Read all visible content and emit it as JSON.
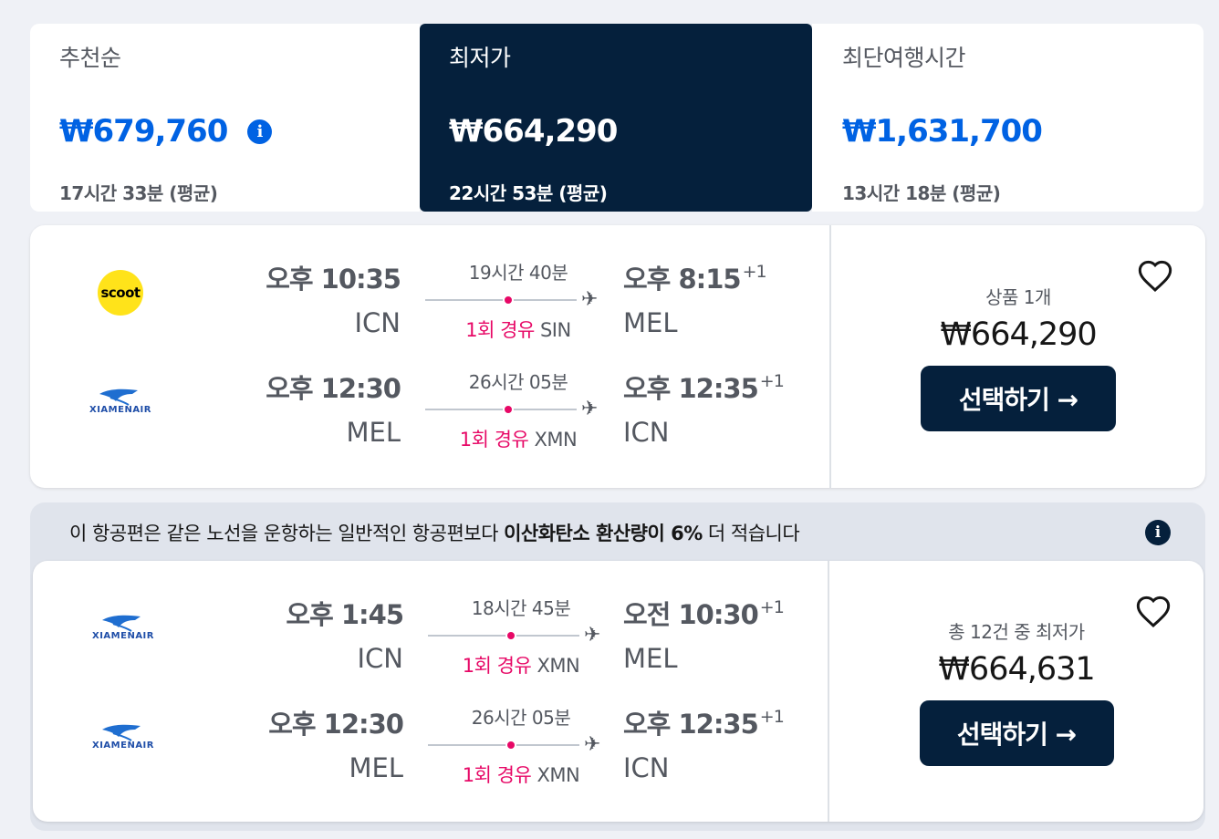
{
  "sort_tabs": [
    {
      "label": "추천순",
      "price": "₩679,760",
      "duration": "17시간 33분 (평균)"
    },
    {
      "label": "최저가",
      "price": "₩664,290",
      "duration": "22시간 53분 (평균)"
    },
    {
      "label": "최단여행시간",
      "price": "₩1,631,700",
      "duration": "13시간 18분 (평균)"
    }
  ],
  "eco_banner": {
    "text_before": "이 항공편은 같은 노선을 운항하는 일반적인 항공편보다 ",
    "text_bold": "이산화탄소 환산량이 6%",
    "text_after": " 더 적습니다"
  },
  "results": [
    {
      "legs": [
        {
          "airline": "scoot",
          "airline_text": "scoot",
          "dep_time": "오후 10:35",
          "dep_code": "ICN",
          "duration": "19시간 40분",
          "stops": "1회 경유",
          "stop_airport": "SIN",
          "arr_time": "오후 8:15",
          "arr_plus": "+1",
          "arr_code": "MEL"
        },
        {
          "airline": "xiamen",
          "airline_text": "XIAMENAIR",
          "dep_time": "오후 12:30",
          "dep_code": "MEL",
          "duration": "26시간 05분",
          "stops": "1회 경유",
          "stop_airport": "XMN",
          "arr_time": "오후 12:35",
          "arr_plus": "+1",
          "arr_code": "ICN"
        }
      ],
      "deal_text": "상품 1개",
      "price": "₩664,290",
      "select_label": "선택하기 →"
    },
    {
      "legs": [
        {
          "airline": "xiamen",
          "airline_text": "XIAMENAIR",
          "dep_time": "오후 1:45",
          "dep_code": "ICN",
          "duration": "18시간 45분",
          "stops": "1회 경유",
          "stop_airport": "XMN",
          "arr_time": "오전 10:30",
          "arr_plus": "+1",
          "arr_code": "MEL"
        },
        {
          "airline": "xiamen",
          "airline_text": "XIAMENAIR",
          "dep_time": "오후 12:30",
          "dep_code": "MEL",
          "duration": "26시간 05분",
          "stops": "1회 경유",
          "stop_airport": "XMN",
          "arr_time": "오후 12:35",
          "arr_plus": "+1",
          "arr_code": "ICN"
        }
      ],
      "deal_text": "총 12건 중 최저가",
      "price": "₩664,631",
      "select_label": "선택하기 →"
    }
  ],
  "colors": {
    "brand_dark": "#05203c",
    "accent_blue": "#0062e3",
    "stop_red": "#e70866",
    "scoot_yellow": "#ffe31a"
  },
  "icons": {
    "info": "info-icon",
    "heart": "heart-icon",
    "plane": "plane-icon"
  }
}
